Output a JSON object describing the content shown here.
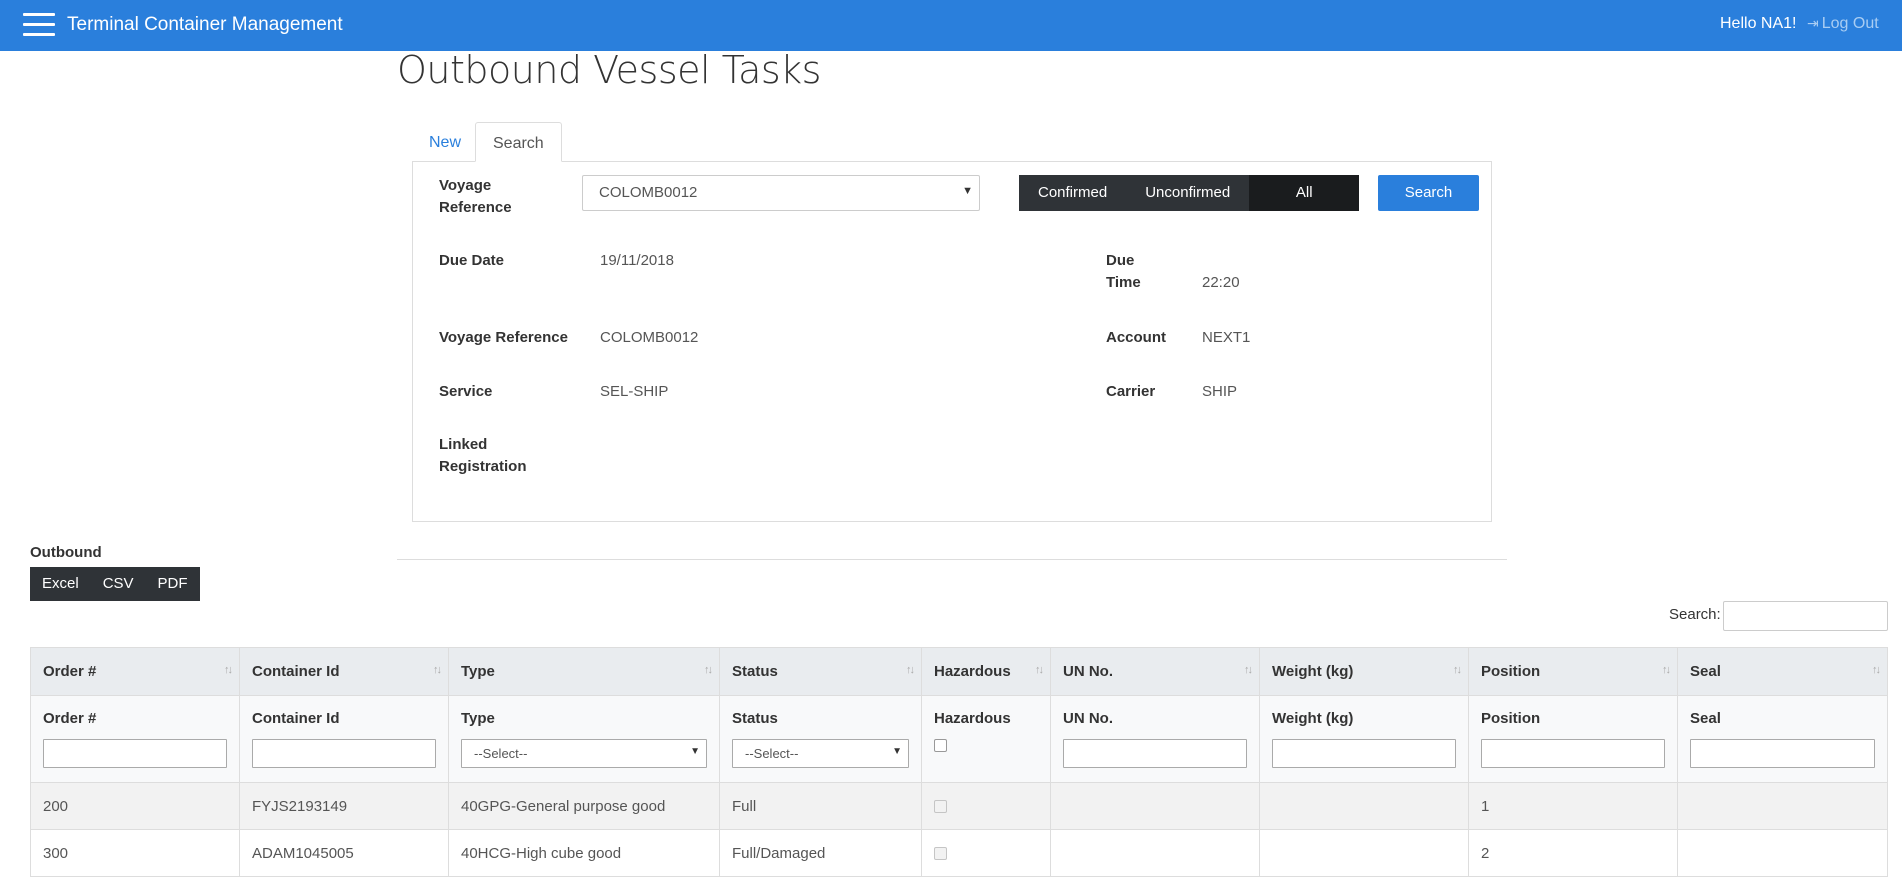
{
  "app": {
    "title": "Terminal Container Management"
  },
  "navbar": {
    "greeting": "Hello NA1!",
    "logout_label": "Log Out"
  },
  "page": {
    "title": "Outbound Vessel Tasks"
  },
  "tabs": [
    {
      "label": "New",
      "active": false
    },
    {
      "label": "Search",
      "active": true
    }
  ],
  "search_form": {
    "voyage_label": "Voyage Reference",
    "voyage_value": "COLOMB0012",
    "filters": [
      "Confirmed",
      "Unconfirmed",
      "All"
    ],
    "active_filter": "All",
    "search_button": "Search"
  },
  "details": {
    "due_date": {
      "label": "Due Date",
      "value": "19/11/2018"
    },
    "due_time": {
      "label": "Due Time",
      "value": "22:20"
    },
    "voyage_ref": {
      "label": "Voyage Reference",
      "value": "COLOMB0012"
    },
    "account": {
      "label": "Account",
      "value": "NEXT1"
    },
    "service": {
      "label": "Service",
      "value": "SEL-SHIP"
    },
    "carrier": {
      "label": "Carrier",
      "value": "SHIP"
    },
    "linked_registration": {
      "label": "Linked Registration",
      "value": ""
    }
  },
  "outbound": {
    "label": "Outbound",
    "export_buttons": [
      "Excel",
      "CSV",
      "PDF"
    ],
    "search_label": "Search:",
    "columns": [
      "Order #",
      "Container Id",
      "Type",
      "Status",
      "Hazardous",
      "UN No.",
      "Weight (kg)",
      "Position",
      "Seal"
    ],
    "filter_select_placeholder": "--Select--",
    "rows": [
      {
        "order": "200",
        "container_id": "FYJS2193149",
        "type": "40GPG-General purpose good",
        "status": "Full",
        "hazardous": false,
        "un_no": "",
        "weight": "",
        "position": "1",
        "seal": ""
      },
      {
        "order": "300",
        "container_id": "ADAM1045005",
        "type": "40HCG-High cube good",
        "status": "Full/Damaged",
        "hazardous": false,
        "un_no": "",
        "weight": "",
        "position": "2",
        "seal": ""
      }
    ]
  },
  "colors": {
    "navbar": "#2a7fdc",
    "dark_button": "#2f3337",
    "active_button": "#1a1c1e",
    "primary": "#2a7fdc"
  }
}
